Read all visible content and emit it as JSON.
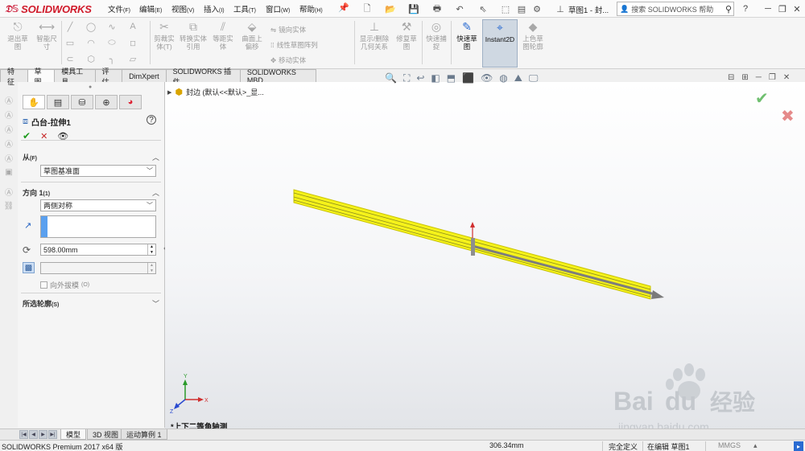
{
  "app": {
    "brand": "SOLIDWORKS",
    "doc_title": "草图1 - 封...",
    "search_placeholder": "搜索 SOLIDWORKS 帮助",
    "help_label": "?"
  },
  "menu": [
    {
      "label": "文件",
      "key": "(F)"
    },
    {
      "label": "编辑",
      "key": "(E)"
    },
    {
      "label": "视图",
      "key": "(V)"
    },
    {
      "label": "插入",
      "key": "(I)"
    },
    {
      "label": "工具",
      "key": "(T)"
    },
    {
      "label": "窗口",
      "key": "(W)"
    },
    {
      "label": "帮助",
      "key": "(H)"
    }
  ],
  "ribbon": {
    "exit_sketch": "退出草图",
    "smart_dim": "智能尺寸",
    "trim": "剪裁实体(T)",
    "convert": "转换实体引用",
    "offset": "等距实体",
    "surface_offset": "曲面上偏移",
    "mirror": "镜向实体",
    "linear_pattern": "线性草图阵列",
    "move": "移动实体",
    "display_relations": "显示/删除几何关系",
    "repair": "修复草图",
    "quick_snap": "快速捕捉",
    "rapid_sketch": "快速草图",
    "instant2d": "Instant2D",
    "shaded_sketch": "上色草图轮廓"
  },
  "tabs": [
    "特征",
    "草图",
    "模具工具",
    "评估",
    "DimXpert",
    "SOLIDWORKS 插件",
    "SOLIDWORKS MBD"
  ],
  "active_tab": "草图",
  "property_manager": {
    "feature_name": "凸台-拉伸1",
    "from_label": "从",
    "from_key": "(F)",
    "from_value": "草图基准面",
    "direction_label": "方向 1",
    "direction_key": "(1)",
    "end_condition": "两侧对称",
    "depth": "598.00mm",
    "draft_outward": "向外拔模",
    "draft_key": "(O)",
    "selected_contours": "所选轮廓",
    "contours_key": "(S)"
  },
  "graphics": {
    "tree_path": "封边 (默认<<默认>_显...",
    "view_caption": "*上下二等角轴测",
    "triad": {
      "x": "X",
      "y": "Y",
      "z": "Z"
    }
  },
  "model_tabs": [
    "模型",
    "3D 视图",
    "运动算例 1"
  ],
  "status": {
    "product": "SOLIDWORKS Premium 2017 x64 版",
    "measure": "306.34mm",
    "defined": "完全定义",
    "editing": "在编辑 草图1",
    "units": "MMGS"
  },
  "watermark": {
    "brand": "Bai",
    "brand2": "du",
    "sub": "经验",
    "url": "jingyan.baidu.com"
  }
}
